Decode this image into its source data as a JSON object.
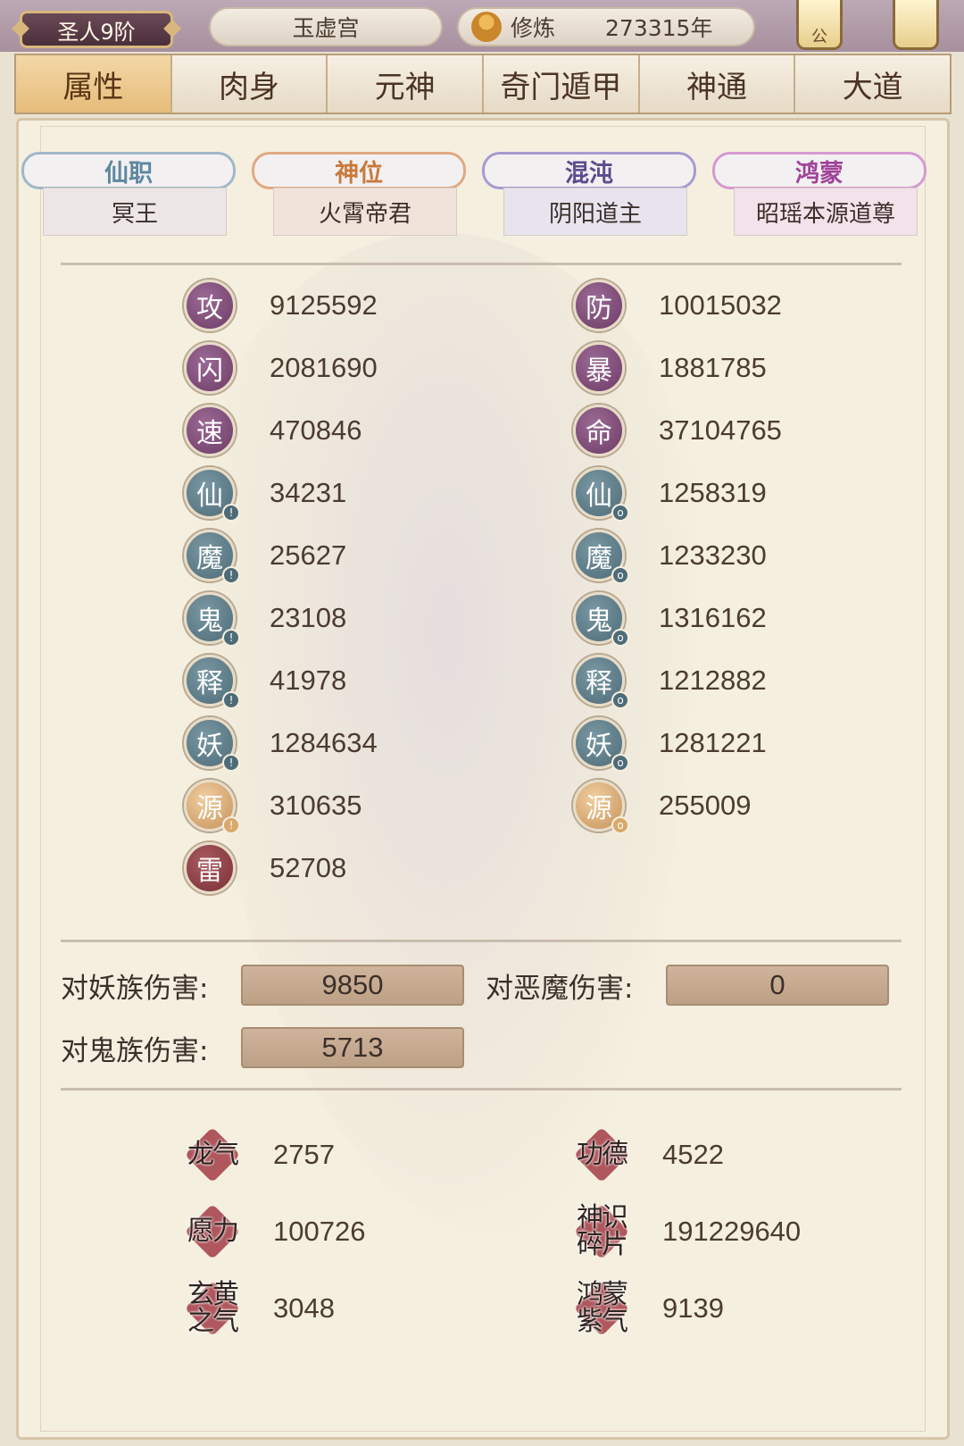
{
  "topbar": {
    "rank": "圣人9阶",
    "location": "玉虚宫",
    "cultivation_label": "修炼",
    "cultivation_value": "273315年",
    "lantern1": "公",
    "lantern2": ""
  },
  "tabs": [
    "属性",
    "肉身",
    "元神",
    "奇门遁甲",
    "神通",
    "大道"
  ],
  "active_tab": "属性",
  "titles": [
    {
      "head": "仙职",
      "body": "冥王"
    },
    {
      "head": "神位",
      "body": "火霄帝君"
    },
    {
      "head": "混沌",
      "body": "阴阳道主"
    },
    {
      "head": "鸿蒙",
      "body": "昭瑶本源道尊"
    }
  ],
  "stats_left": [
    {
      "icon": "攻",
      "value": "9125592"
    },
    {
      "icon": "闪",
      "value": "2081690"
    },
    {
      "icon": "速",
      "value": "470846"
    },
    {
      "icon": "仙",
      "value": "34231"
    },
    {
      "icon": "魔",
      "value": "25627"
    },
    {
      "icon": "鬼",
      "value": "23108"
    },
    {
      "icon": "释",
      "value": "41978"
    },
    {
      "icon": "妖",
      "value": "1284634"
    },
    {
      "icon": "源",
      "value": "310635"
    },
    {
      "icon": "雷",
      "value": "52708"
    }
  ],
  "stats_right": [
    {
      "icon": "防",
      "value": "10015032"
    },
    {
      "icon": "暴",
      "value": "1881785"
    },
    {
      "icon": "命",
      "value": "37104765"
    },
    {
      "icon": "仙",
      "value": "1258319"
    },
    {
      "icon": "魔",
      "value": "1233230"
    },
    {
      "icon": "鬼",
      "value": "1316162"
    },
    {
      "icon": "释",
      "value": "1212882"
    },
    {
      "icon": "妖",
      "value": "1281221"
    },
    {
      "icon": "源",
      "value": "255009"
    }
  ],
  "damage": [
    {
      "label": "对妖族伤害:",
      "value": "9850"
    },
    {
      "label": "对恶魔伤害:",
      "value": "0"
    },
    {
      "label": "对鬼族伤害:",
      "value": "5713"
    }
  ],
  "resources": [
    {
      "icon": "龙气",
      "value": "2757"
    },
    {
      "icon": "功德",
      "value": "4522"
    },
    {
      "icon": "愿力",
      "value": "100726"
    },
    {
      "icon": "神识碎片",
      "value": "191229640"
    },
    {
      "icon": "玄黄之气",
      "value": "3048"
    },
    {
      "icon": "鸿蒙紫气",
      "value": "9139"
    }
  ],
  "colors": {
    "attack_badge": "#6d3b66",
    "resist_badge": "#4e6c77",
    "source_badge": "#c4915a",
    "thunder_badge": "#7a3038",
    "damage_box": "#bda187"
  }
}
